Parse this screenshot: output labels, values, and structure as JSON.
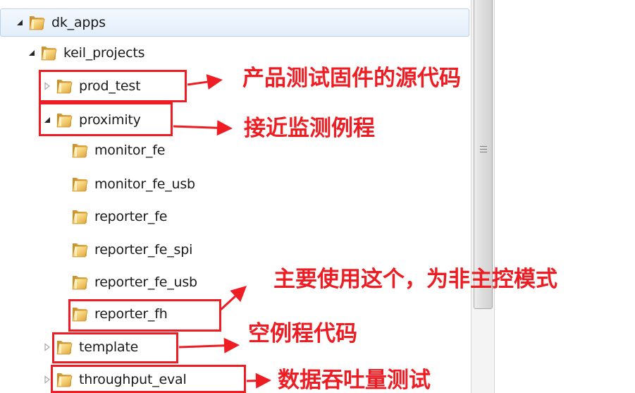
{
  "tree": {
    "items": [
      {
        "label": "dk_apps",
        "expander": "expanded"
      },
      {
        "label": "keil_projects",
        "expander": "expanded"
      },
      {
        "label": "prod_test",
        "expander": "collapsed"
      },
      {
        "label": "proximity",
        "expander": "expanded"
      },
      {
        "label": "monitor_fe",
        "expander": "none"
      },
      {
        "label": "monitor_fe_usb",
        "expander": "none"
      },
      {
        "label": "reporter_fe",
        "expander": "none"
      },
      {
        "label": "reporter_fe_spi",
        "expander": "none"
      },
      {
        "label": "reporter_fe_usb",
        "expander": "none"
      },
      {
        "label": "reporter_fh",
        "expander": "none"
      },
      {
        "label": "template",
        "expander": "collapsed"
      },
      {
        "label": "throughput_eval",
        "expander": "collapsed"
      }
    ],
    "selected_index": 0
  },
  "annotations": [
    {
      "text": "产品测试固件的源代码"
    },
    {
      "text": "接近监测例程"
    },
    {
      "text": "主要使用这个，为非主控模式"
    },
    {
      "text": "空例程代码"
    },
    {
      "text": "数据吞吐量测试"
    }
  ],
  "colors": {
    "annotation": "#ee1d23",
    "selection_border": "#b7d2ee",
    "folder": "#f2c14e"
  },
  "icons": {
    "folder": "folder-icon",
    "expanded": "triangle-expanded-icon",
    "collapsed": "triangle-collapsed-icon",
    "scroll_grip": "grip-lines-icon"
  }
}
